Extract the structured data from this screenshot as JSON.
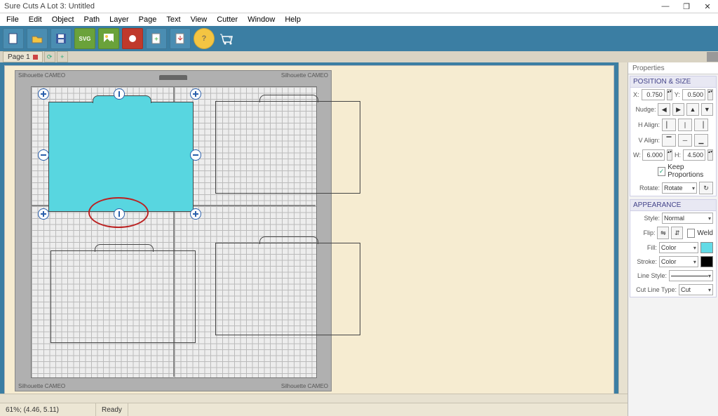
{
  "title": "Sure Cuts A Lot 3: Untitled",
  "menu": [
    "File",
    "Edit",
    "Object",
    "Path",
    "Layer",
    "Page",
    "Text",
    "View",
    "Cutter",
    "Window",
    "Help"
  ],
  "tabs": {
    "page_label": "Page 1"
  },
  "mat": {
    "brand": "Silhouette CAMEO"
  },
  "status": {
    "zoom_coords": "61%; (4.46, 5.11)",
    "state": "Ready"
  },
  "props": {
    "panel_title": "Properties",
    "pos_size": {
      "title": "POSITION & SIZE",
      "x_label": "X:",
      "x": "0.750",
      "y_label": "Y:",
      "y": "0.500",
      "nudge_label": "Nudge:",
      "halign_label": "H Align:",
      "valign_label": "V Align:",
      "w_label": "W:",
      "w": "6.000",
      "h_label": "H:",
      "h": "4.500",
      "keep_label": "Keep Proportions",
      "rotate_label": "Rotate:",
      "rotate_value": "Rotate"
    },
    "appearance": {
      "title": "APPEARANCE",
      "style_label": "Style:",
      "style_value": "Normal",
      "flip_label": "Flip:",
      "weld_label": "Weld",
      "fill_label": "Fill:",
      "fill_value": "Color",
      "fill_color": "#63dbe6",
      "stroke_label": "Stroke:",
      "stroke_value": "Color",
      "stroke_color": "#000000",
      "linestyle_label": "Line Style:",
      "cutline_label": "Cut Line Type:",
      "cutline_value": "Cut"
    }
  }
}
